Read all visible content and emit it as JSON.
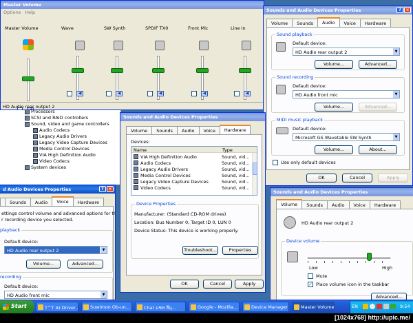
{
  "master_volume": {
    "title": "Master Volume",
    "menu": [
      "Options",
      "Help"
    ],
    "channels": [
      {
        "label": "Master Volume",
        "level": 0.72
      },
      {
        "label": "Wave",
        "level": 0.72
      },
      {
        "label": "SW Synth",
        "level": 0.72
      },
      {
        "label": "SPDIF TX0",
        "level": 0.72
      },
      {
        "label": "Front Mic",
        "level": 0.72
      },
      {
        "label": "Line In",
        "level": 0.72
      }
    ],
    "status": "HD Audio rear output 2"
  },
  "snd_audio_props": {
    "title": "Sounds and Audio Devices Properties",
    "tabs": [
      "Volume",
      "Sounds",
      "Audio",
      "Voice",
      "Hardware"
    ],
    "active_tab": "Audio",
    "playback": {
      "legend": "Sound playback",
      "label": "Default device:",
      "value": "HD Audio rear output 2",
      "volume_btn": "Volume...",
      "advanced_btn": "Advanced..."
    },
    "recording": {
      "legend": "Sound recording",
      "label": "Default device:",
      "value": "HD Audio front mic",
      "volume_btn": "Volume...",
      "advanced_btn": "Advanced..."
    },
    "midi": {
      "legend": "MIDI music playback",
      "label": "Default device:",
      "value": "Microsoft GS Wavetable SW Synth",
      "volume_btn": "Volume...",
      "about_btn": "About..."
    },
    "only_default": "Use only default devices",
    "ok": "OK",
    "cancel": "Cancel",
    "apply": "Apply"
  },
  "device_tree": {
    "items": [
      {
        "label": "Processors",
        "indent": 0
      },
      {
        "label": "SCSI and RAID controllers",
        "indent": 0
      },
      {
        "label": "Sound, video and game controllers",
        "indent": 0
      },
      {
        "label": "Audio Codecs",
        "indent": 1
      },
      {
        "label": "Legacy Audio Drivers",
        "indent": 1
      },
      {
        "label": "Legacy Video Capture Devices",
        "indent": 1
      },
      {
        "label": "Media Control Devices",
        "indent": 1
      },
      {
        "label": "VIA High Definition Audio",
        "indent": 1
      },
      {
        "label": "Video Codecs",
        "indent": 1
      },
      {
        "label": "System devices",
        "indent": 0
      }
    ]
  },
  "snd_hw_props": {
    "title": "Sounds and Audio Devices Properties",
    "tabs": [
      "Volume",
      "Sounds",
      "Audio",
      "Voice",
      "Hardware"
    ],
    "active_tab": "Hardware",
    "devices_label": "Devices:",
    "columns": [
      "Name",
      "Type"
    ],
    "rows": [
      {
        "name": "VIA High Definition Audio",
        "type": "Sound, vid..."
      },
      {
        "name": "Audio Codecs",
        "type": "Sound, vid..."
      },
      {
        "name": "Legacy Audio Drivers",
        "type": "Sound, vid..."
      },
      {
        "name": "Media Control Devices",
        "type": "Sound, vid..."
      },
      {
        "name": "Legacy Video Capture Devices",
        "type": "Sound, vid..."
      },
      {
        "name": "Video Codecs",
        "type": "Sound, vid..."
      }
    ],
    "props_legend": "Device Properties",
    "manufacturer": "Manufacturer: (Standard CD-ROM drives)",
    "location": "Location: Bus Number 0, Target ID 0, LUN 0",
    "status": "Device Status: This device is working properly.",
    "troubleshoot": "Troubleshoot...",
    "properties": "Properties",
    "ok": "OK",
    "cancel": "Cancel",
    "apply": "Apply"
  },
  "snd_voice_props": {
    "title": "d Audio Devices Properties",
    "tabs": [
      "",
      "Sounds",
      "Audio",
      "Voice",
      "Hardware"
    ],
    "active_tab": "Voice",
    "desc_line1": "ettings control volume and advanced options for the voice",
    "desc_line2": "r recording device you selected.",
    "playback_legend": "playback",
    "playback_label": "Default device:",
    "playback_value": "HD Audio rear output 2",
    "volume_btn": "Volume...",
    "advanced_btn": "Advanced...",
    "recording_legend": "recording",
    "recording_label": "Default device:",
    "recording_value": "HD Audio front mic"
  },
  "snd_volume_props": {
    "title": "Sounds and Audio Devices Properties",
    "tabs": [
      "Volume",
      "Sounds",
      "Audio",
      "Voice",
      "Hardware"
    ],
    "active_tab": "Volume",
    "device_name": "HD Audio rear output 2",
    "volume_legend": "Device volume",
    "low": "Low",
    "high": "High",
    "volume_level": 0.72,
    "mute": "Mute",
    "place_icon": "Place volume icon in the taskbar",
    "advanced_btn": "Advanced..."
  },
  "taskbar": {
    "start": "Start",
    "items": [
      "T^T ลง Driver ...",
      "Suwimon Ob-un...",
      "Chat แชท ลีนุ...",
      "Google - Mozilla...",
      "Device Manager",
      "Master Volume"
    ],
    "lang": "EN",
    "time": "9:54"
  },
  "watermark": "[1024x768] http://upic.me/"
}
